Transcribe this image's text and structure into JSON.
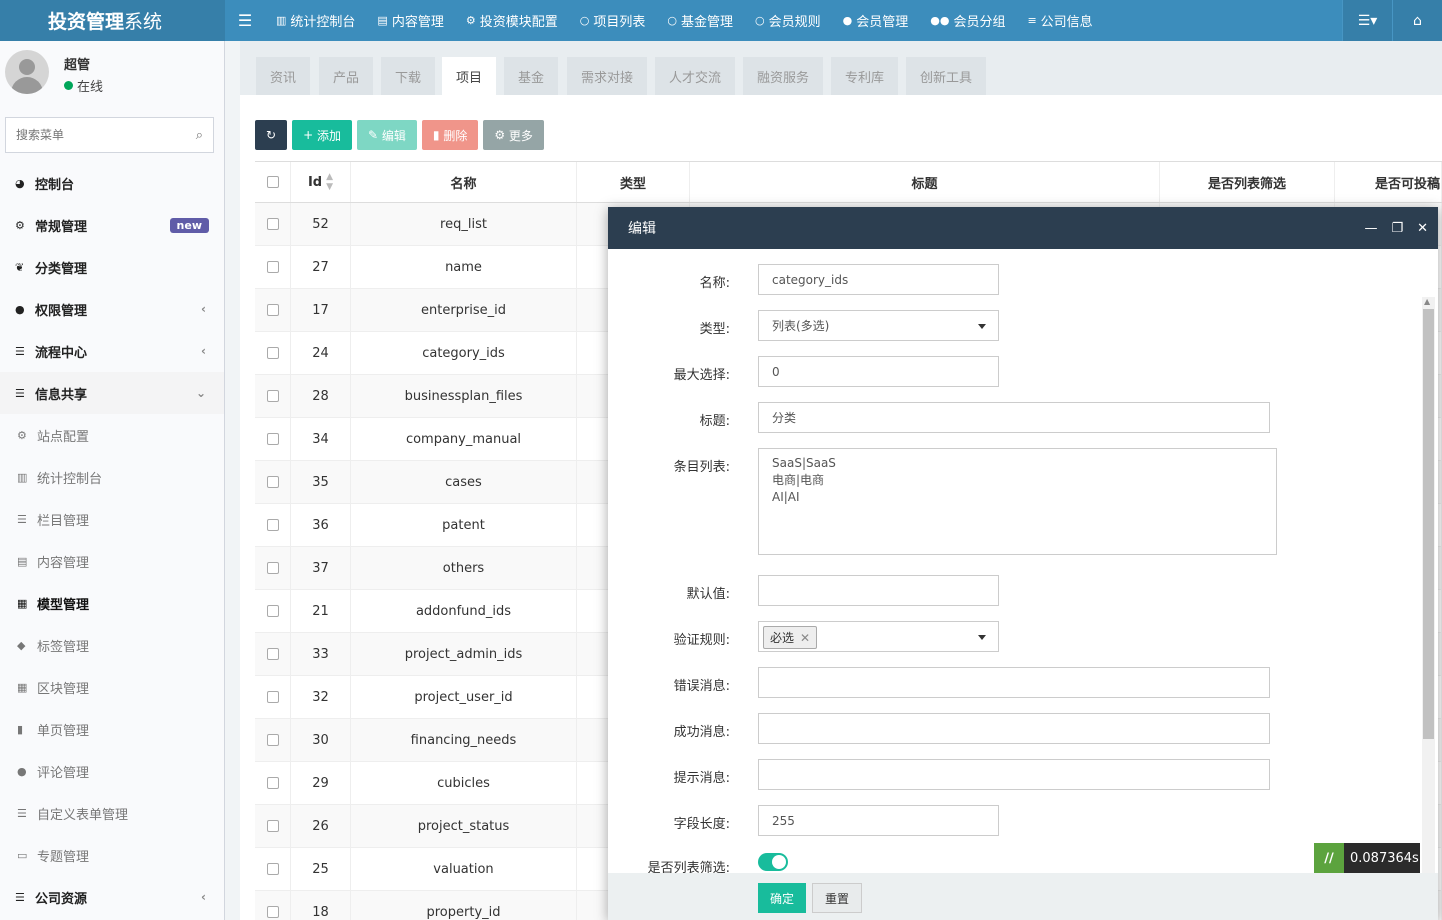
{
  "app": {
    "title_bold": "投资管理",
    "title_light": "系统"
  },
  "topnav": {
    "toggle_icon": "menu-icon",
    "items": [
      {
        "label": "统计控制台",
        "icon": "bar-chart-icon"
      },
      {
        "label": "内容管理",
        "icon": "file-icon"
      },
      {
        "label": "投资模块配置",
        "icon": "cogs-icon"
      },
      {
        "label": "项目列表",
        "icon": "circle-icon"
      },
      {
        "label": "基金管理",
        "icon": "circle-icon"
      },
      {
        "label": "会员规则",
        "icon": "circle-icon"
      },
      {
        "label": "会员管理",
        "icon": "user-icon"
      },
      {
        "label": "会员分组",
        "icon": "users-icon"
      },
      {
        "label": "公司信息",
        "icon": "list-icon"
      }
    ],
    "right_menu_icon": "list-dropdown-icon",
    "home_icon": "home-icon"
  },
  "user": {
    "name": "超管",
    "status": "在线",
    "status_color": "#00a65a"
  },
  "sidebar": {
    "search_placeholder": "搜索菜单",
    "items": [
      {
        "label": "控制台",
        "icon": "dashboard-icon",
        "level": "top"
      },
      {
        "label": "常规管理",
        "icon": "cogs-icon",
        "level": "top",
        "badge": "new"
      },
      {
        "label": "分类管理",
        "icon": "leaf-icon",
        "level": "top"
      },
      {
        "label": "权限管理",
        "icon": "users-icon",
        "level": "top",
        "arrow": "‹"
      },
      {
        "label": "流程中心",
        "icon": "list-icon",
        "level": "top",
        "arrow": "‹"
      },
      {
        "label": "信息共享",
        "icon": "list-icon",
        "level": "top",
        "arrow": "⌄"
      },
      {
        "label": "站点配置",
        "icon": "cogs-icon",
        "level": "sub"
      },
      {
        "label": "统计控制台",
        "icon": "bar-chart-icon",
        "level": "sub"
      },
      {
        "label": "栏目管理",
        "icon": "list-icon",
        "level": "sub"
      },
      {
        "label": "内容管理",
        "icon": "file-icon",
        "level": "sub"
      },
      {
        "label": "模型管理",
        "icon": "grid-icon",
        "level": "sub",
        "active": true
      },
      {
        "label": "标签管理",
        "icon": "tags-icon",
        "level": "sub"
      },
      {
        "label": "区块管理",
        "icon": "th-large-icon",
        "level": "sub"
      },
      {
        "label": "单页管理",
        "icon": "file-icon",
        "level": "sub"
      },
      {
        "label": "评论管理",
        "icon": "comment-icon",
        "level": "sub"
      },
      {
        "label": "自定义表单管理",
        "icon": "list-icon",
        "level": "sub"
      },
      {
        "label": "专题管理",
        "icon": "newspaper-icon",
        "level": "sub"
      },
      {
        "label": "公司资源",
        "icon": "list-icon",
        "level": "top",
        "arrow": "‹"
      }
    ]
  },
  "tabs": [
    "资讯",
    "产品",
    "下载",
    "项目",
    "基金",
    "需求对接",
    "人才交流",
    "融资服务",
    "专利库",
    "创新工具"
  ],
  "active_tab": "项目",
  "toolbar": {
    "refresh_icon": "refresh-icon",
    "add": "添加",
    "edit": "编辑",
    "delete": "删除",
    "more": "更多"
  },
  "table": {
    "headers": [
      "Id",
      "名称",
      "类型",
      "标题",
      "是否列表筛选",
      "是否可投稿"
    ],
    "rows": [
      {
        "id": "52",
        "name": "req_list"
      },
      {
        "id": "27",
        "name": "name"
      },
      {
        "id": "17",
        "name": "enterprise_id"
      },
      {
        "id": "24",
        "name": "category_ids"
      },
      {
        "id": "28",
        "name": "businessplan_files"
      },
      {
        "id": "34",
        "name": "company_manual"
      },
      {
        "id": "35",
        "name": "cases"
      },
      {
        "id": "36",
        "name": "patent"
      },
      {
        "id": "37",
        "name": "others"
      },
      {
        "id": "21",
        "name": "addonfund_ids"
      },
      {
        "id": "33",
        "name": "project_admin_ids"
      },
      {
        "id": "32",
        "name": "project_user_id"
      },
      {
        "id": "30",
        "name": "financing_needs"
      },
      {
        "id": "29",
        "name": "cubicles"
      },
      {
        "id": "26",
        "name": "project_status"
      },
      {
        "id": "25",
        "name": "valuation"
      },
      {
        "id": "18",
        "name": "property_id"
      }
    ]
  },
  "modal": {
    "title": "编辑",
    "fields": {
      "name": {
        "label": "名称:",
        "value": "category_ids"
      },
      "type": {
        "label": "类型:",
        "value": "列表(多选)"
      },
      "max": {
        "label": "最大选择:",
        "value": "0"
      },
      "title": {
        "label": "标题:",
        "value": "分类"
      },
      "items": {
        "label": "条目列表:",
        "lines": [
          "SaaS|SaaS",
          "电商|电商",
          "AI|AI"
        ]
      },
      "default": {
        "label": "默认值:",
        "value": ""
      },
      "rule": {
        "label": "验证规则:",
        "tag": "必选"
      },
      "error": {
        "label": "错误消息:",
        "value": ""
      },
      "success": {
        "label": "成功消息:",
        "value": ""
      },
      "tip": {
        "label": "提示消息:",
        "value": ""
      },
      "length": {
        "label": "字段长度:",
        "value": "255"
      },
      "filter": {
        "label": "是否列表筛选:",
        "on": true
      }
    },
    "ok": "确定",
    "reset": "重置"
  },
  "timer": "0.087364s"
}
